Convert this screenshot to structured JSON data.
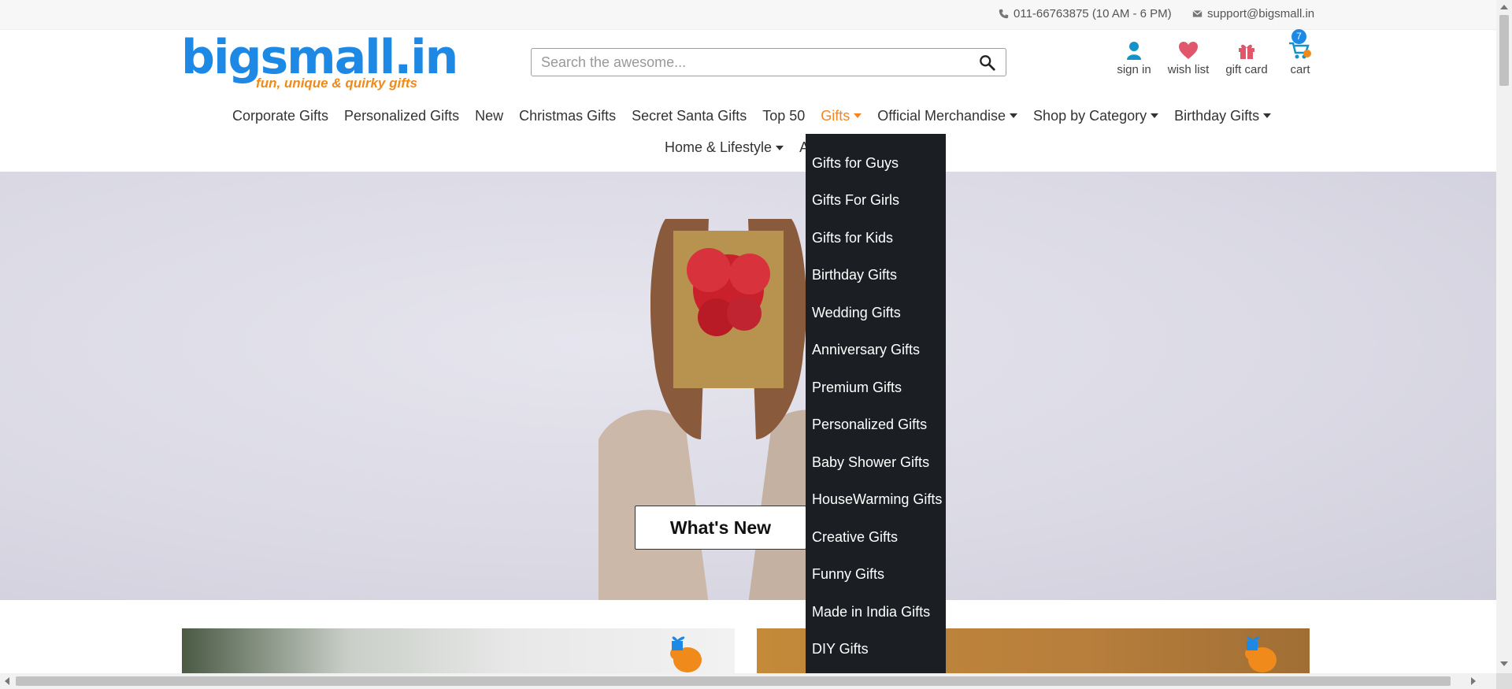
{
  "topbar": {
    "phone": "011-66763875 (10 AM - 6 PM)",
    "email": "support@bigsmall.in"
  },
  "header": {
    "logo_text": "bigsmall.in",
    "tagline": "fun, unique & quirky gifts",
    "search_placeholder": "Search the awesome...",
    "signin_label": "sign in",
    "wishlist_label": "wish list",
    "giftcard_label": "gift card",
    "cart_label": "cart",
    "cart_count": "7"
  },
  "nav": {
    "row1": [
      {
        "label": "Corporate Gifts"
      },
      {
        "label": "Personalized Gifts"
      },
      {
        "label": "New"
      },
      {
        "label": "Christmas Gifts"
      },
      {
        "label": "Secret Santa Gifts"
      },
      {
        "label": "Top 50"
      },
      {
        "label": "Gifts"
      },
      {
        "label": "Official Merchandise"
      },
      {
        "label": "Shop by Category"
      },
      {
        "label": "Birthday Gifts"
      }
    ],
    "row2": [
      {
        "label": "Home & Lifestyle"
      },
      {
        "label": "A"
      }
    ]
  },
  "dropdown": {
    "items": [
      "Gifts for Guys",
      "Gifts For Girls",
      "Gifts for Kids",
      "Birthday Gifts",
      "Wedding Gifts",
      "Anniversary Gifts",
      "Premium Gifts",
      "Personalized Gifts",
      "Baby Shower Gifts",
      "HouseWarming Gifts",
      "Creative Gifts",
      "Funny Gifts",
      "Made in India Gifts",
      "DIY Gifts"
    ]
  },
  "hero": {
    "cta_label": "What's New"
  },
  "colors": {
    "brand_blue": "#1e88e5",
    "accent_orange": "#f5851f",
    "dropdown_bg": "#1b1f24"
  }
}
